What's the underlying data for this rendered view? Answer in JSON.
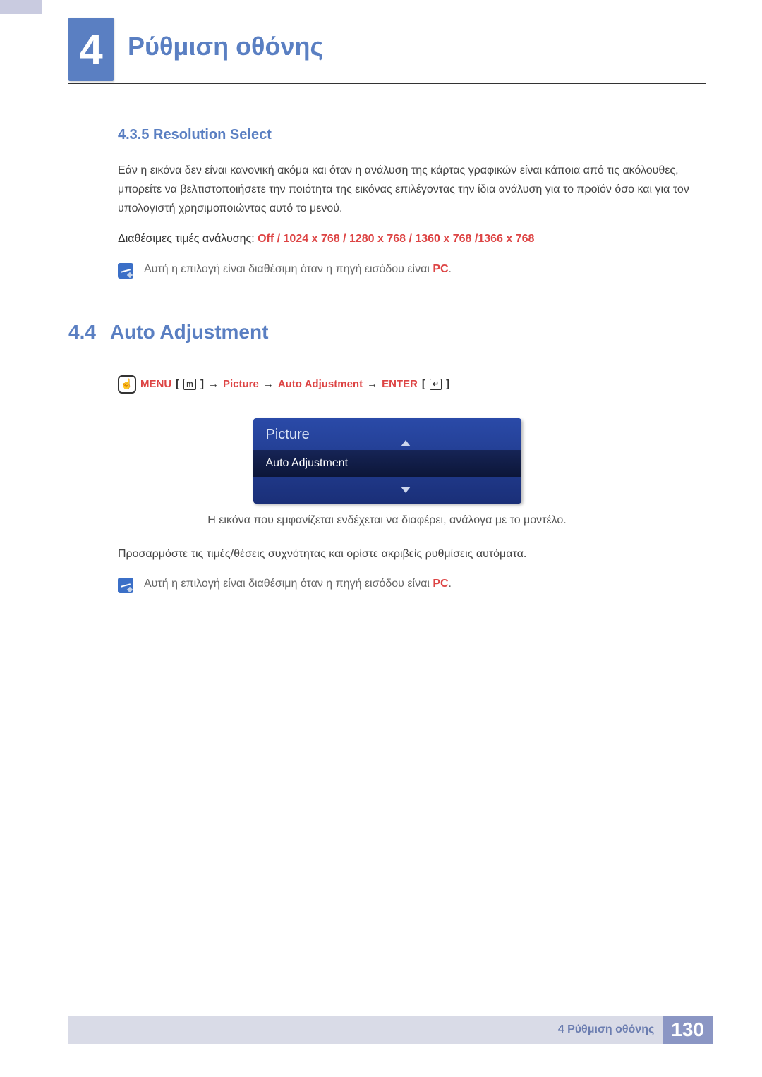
{
  "header": {
    "chapter_number": "4",
    "chapter_title": "Ρύθμιση οθόνης"
  },
  "subsection": {
    "number_title": "4.3.5  Resolution Select",
    "body": "Εάν η εικόνα δεν είναι κανονική ακόμα και όταν η ανάλυση της κάρτας γραφικών είναι κάποια από τις ακόλουθες, μπορείτε να βελτιστοποιήσετε την ποιότητα της εικόνας επιλέγοντας την ίδια ανάλυση για το προϊόν όσο και για τον υπολογιστή χρησιμοποιώντας αυτό το μενού.",
    "avail_prefix": "Διαθέσιμες τιμές ανάλυσης: ",
    "avail_values": "Off / 1024 x 768 / 1280 x 768 / 1360 x 768 /1366 x 768",
    "note_text_prefix": "Αυτή η επιλογή είναι διαθέσιμη όταν η πηγή εισόδου είναι ",
    "note_pc": "PC",
    "note_suffix": "."
  },
  "section": {
    "number": "4.4",
    "title": "Auto Adjustment"
  },
  "menu_path": {
    "menu": "MENU",
    "menu_icon": "m",
    "arrow": "→",
    "picture": "Picture",
    "auto_adj": "Auto Adjustment",
    "enter": "ENTER",
    "enter_icon": "↵"
  },
  "osd": {
    "title": "Picture",
    "item": "Auto Adjustment"
  },
  "caption": "Η εικόνα που εμφανίζεται ενδέχεται να διαφέρει, ανάλογα με το μοντέλο.",
  "body2": "Προσαρμόστε τις τιμές/θέσεις συχνότητας και ορίστε ακριβείς ρυθμίσεις αυτόματα.",
  "note2": {
    "prefix": "Αυτή η επιλογή είναι διαθέσιμη όταν η πηγή εισόδου είναι ",
    "pc": "PC",
    "suffix": "."
  },
  "footer": {
    "text": "4 Ρύθμιση οθόνης",
    "page": "130"
  }
}
